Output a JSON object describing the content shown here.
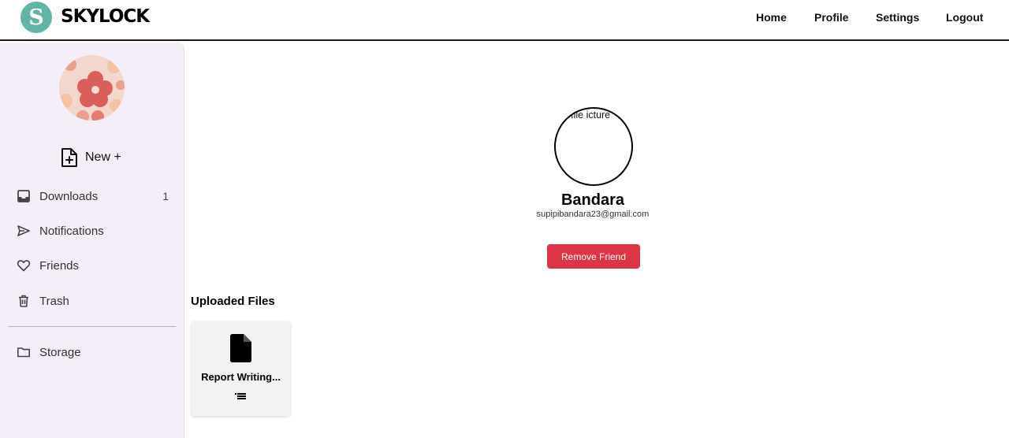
{
  "brand": {
    "name": "SKYLOCK",
    "logo_letter": "S",
    "logo_color": "#63b3a6"
  },
  "nav": {
    "home": "Home",
    "profile": "Profile",
    "settings": "Settings",
    "logout": "Logout"
  },
  "sidebar": {
    "new_label": "New +",
    "items": [
      {
        "label": "Downloads",
        "count": "1",
        "icon": "inbox-icon"
      },
      {
        "label": "Notifications",
        "icon": "send-icon"
      },
      {
        "label": "Friends",
        "icon": "heart-icon"
      },
      {
        "label": "Trash",
        "icon": "trash-icon"
      },
      {
        "label": "Storage",
        "icon": "folder-icon"
      }
    ]
  },
  "profile": {
    "picture_alt": "rofile icture",
    "name": "Bandara",
    "email": "supipibandara23@gmail.com",
    "remove_label": "Remove Friend"
  },
  "files": {
    "title": "Uploaded Files",
    "items": [
      {
        "name": "Report Writing...",
        "icon": "file-icon"
      }
    ]
  },
  "colors": {
    "danger": "#dc3545",
    "sidebar_bg": "#f3eef7"
  }
}
